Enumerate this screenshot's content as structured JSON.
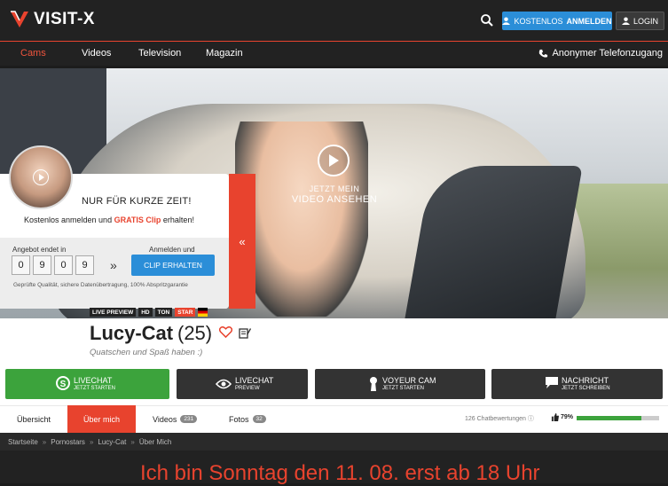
{
  "header": {
    "logo_text": "VISIT-X",
    "register_label_pre": "KOSTENLOS",
    "register_label_bold": "ANMELDEN",
    "login_label": "LOGIN"
  },
  "nav": {
    "items": [
      "Cams",
      "Videos",
      "Television",
      "Magazin"
    ],
    "active": "Cams",
    "phone_label": "Anonymer Telefonzugang"
  },
  "hero": {
    "play_line1": "JETZT MEIN",
    "play_line2": "VIDEO ANSEHEN"
  },
  "promo": {
    "headline": "NUR FÜR KURZE ZEIT!",
    "sub_pre": "Kostenlos anmelden und ",
    "sub_highlight": "GRATIS Clip",
    "sub_post": " erhalten!",
    "offer_ends_label": "Angebot endet in",
    "digits": [
      "0",
      "9",
      "0",
      "9"
    ],
    "signin_label": "Anmelden und",
    "clip_button": "CLIP ERHALTEN",
    "fine_print": "Geprüfte Qualität, sichere Datenübertragung, 100% Abspritzgarantie",
    "handle_glyph": "«"
  },
  "profile": {
    "badges": [
      "LIVE PREVIEW",
      "HD",
      "TON",
      "STAR"
    ],
    "name": "Lucy-Cat",
    "age": "(25)",
    "tagline": "Quatschen und Spaß haben :)"
  },
  "actions": [
    {
      "title": "LIVECHAT",
      "subtitle": "JETZT STARTEN"
    },
    {
      "title": "LIVECHAT",
      "subtitle": "PREVIEW"
    },
    {
      "title": "VOYEUR CAM",
      "subtitle": "JETZT STARTEN"
    },
    {
      "title": "NACHRICHT",
      "subtitle": "JETZT SCHREIBEN"
    }
  ],
  "tabs": {
    "overview": "Übersicht",
    "about": "Über mich",
    "videos": "Videos",
    "videos_count": "231",
    "photos": "Fotos",
    "photos_count": "32",
    "ratings": "126 Chatbewertungen",
    "percent": "79%",
    "percent_value": 0.79
  },
  "breadcrumb": [
    "Startseite",
    "Pornostars",
    "Lucy-Cat",
    "Über Mich"
  ],
  "bottom_message": "Ich bin Sonntag den 11. 08. erst ab 18 Uhr",
  "colors": {
    "accent": "#e8432e",
    "blue": "#2b8ed8",
    "green": "#3ca33c"
  }
}
